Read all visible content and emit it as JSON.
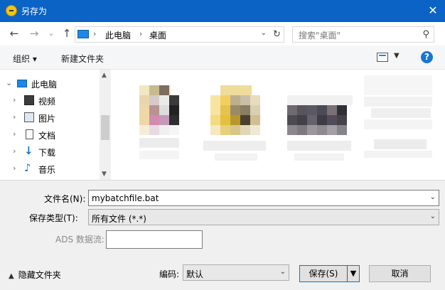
{
  "titlebar": {
    "title": "另存为",
    "close_glyph": "✕"
  },
  "nav": {
    "back_glyph": "←",
    "forward_glyph": "→",
    "recent_glyph": "⌄",
    "up_glyph": "↑",
    "breadcrumb": [
      "此电脑",
      "桌面"
    ],
    "sep_glyph": "›",
    "refresh_glyph": "↻",
    "search_placeholder": "搜索\"桌面\"",
    "search_glyph": "⚲"
  },
  "toolbar": {
    "organize": "组织 ▾",
    "new_folder": "新建文件夹",
    "help": "?"
  },
  "sidebar": {
    "items": [
      {
        "label": "此电脑",
        "icon": "computer-icon"
      },
      {
        "label": "视频",
        "icon": "video-icon"
      },
      {
        "label": "图片",
        "icon": "pictures-icon"
      },
      {
        "label": "文档",
        "icon": "documents-icon"
      },
      {
        "label": "下载",
        "icon": "download-icon"
      },
      {
        "label": "音乐",
        "icon": "music-icon"
      }
    ],
    "collapse_glyph": "⌄",
    "expand_glyph": "›"
  },
  "form": {
    "filename_label": "文件名(N):",
    "filename_value": "mybatchfile.bat",
    "filetype_label": "保存类型(T):",
    "filetype_value": "所有文件 (*.*)",
    "ads_label": "ADS 数据流:",
    "ads_value": "",
    "encoding_label": "编码:",
    "encoding_value": "默认",
    "save_label": "保存(S)",
    "cancel_label": "取消",
    "hide_folders_label": "隐藏文件夹"
  },
  "colors": {
    "title_bar": "#0a63c5",
    "accent": "#0078d7"
  }
}
